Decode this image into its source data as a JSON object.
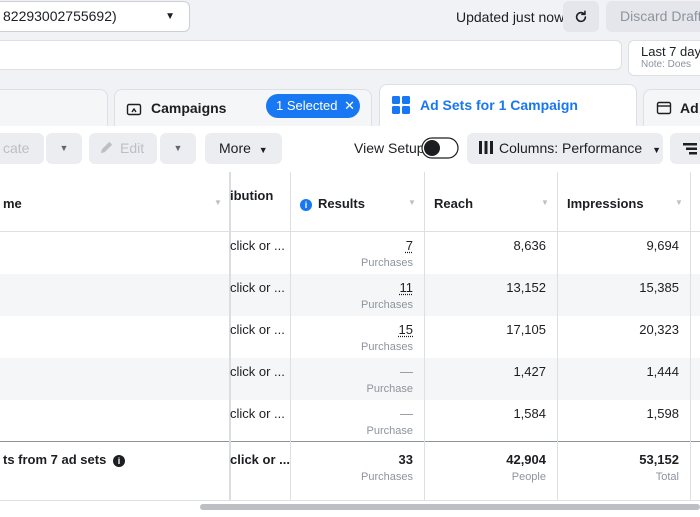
{
  "topbar": {
    "account_label": "82293002755692)",
    "updated_text": "Updated just now",
    "discard_label": "Discard Draft"
  },
  "daterange": {
    "label": "Last 7 day",
    "note": "Note: Does"
  },
  "tabs": {
    "campaigns_label": "Campaigns",
    "selected_label": "1 Selected",
    "adsets_label": "Ad Sets for 1 Campaign",
    "ads_label": "Ad"
  },
  "toolbar": {
    "duplicate_label": "cate",
    "edit_label": "Edit",
    "more_label": "More",
    "view_setup_label": "View Setup",
    "columns_label": "Columns: Performance"
  },
  "table": {
    "headers": {
      "name": "me",
      "attribution_line1": "ibution",
      "attribution_line2": "",
      "results": "Results",
      "reach": "Reach",
      "impressions": "Impressions"
    },
    "rows": [
      {
        "attribution": "click or ...",
        "results": "7",
        "results_unit": "Purchases",
        "reach": "8,636",
        "impressions": "9,694"
      },
      {
        "attribution": "click or ...",
        "results": "11",
        "results_unit": "Purchases",
        "reach": "13,152",
        "impressions": "15,385"
      },
      {
        "attribution": "click or ...",
        "results": "15",
        "results_unit": "Purchases",
        "reach": "17,105",
        "impressions": "20,323"
      },
      {
        "attribution": "click or ...",
        "results": "—",
        "results_unit": "Purchase",
        "reach": "1,427",
        "impressions": "1,444"
      },
      {
        "attribution": "click or ...",
        "results": "—",
        "results_unit": "Purchase",
        "reach": "1,584",
        "impressions": "1,598"
      }
    ],
    "total": {
      "name": "ts from 7 ad sets",
      "attribution": "click or ...",
      "results": "33",
      "results_unit": "Purchases",
      "reach": "42,904",
      "reach_unit": "People",
      "impressions": "53,152",
      "impressions_unit": "Total"
    }
  },
  "colors": {
    "accent": "#1877f2",
    "background": "#f0f2f5",
    "border": "#dddfe2"
  }
}
